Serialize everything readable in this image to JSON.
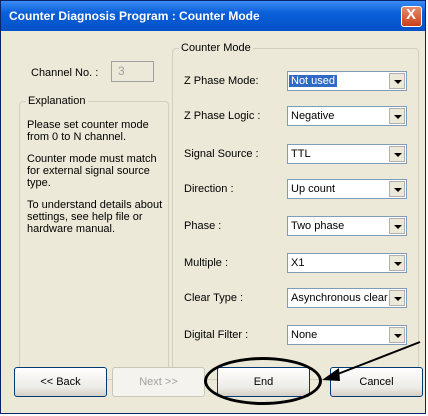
{
  "window": {
    "title": "Counter Diagnosis Program : Counter Mode",
    "close_label": "X"
  },
  "channel": {
    "label": "Channel No. :",
    "value": "3"
  },
  "explanation": {
    "title": "Explanation",
    "paragraphs": [
      "Please set counter mode from 0 to N channel.",
      "Counter mode must match for external signal source type.",
      "To understand details about settings, see help file or hardware manual."
    ]
  },
  "counter_mode": {
    "title": "Counter Mode",
    "fields": [
      {
        "label": "Z Phase Mode:",
        "value": "Not used"
      },
      {
        "label": "Z Phase Logic :",
        "value": "Negative"
      },
      {
        "label": "Signal Source :",
        "value": "TTL"
      },
      {
        "label": "Direction :",
        "value": "Up count"
      },
      {
        "label": "Phase :",
        "value": "Two phase"
      },
      {
        "label": "Multiple :",
        "value": "X1"
      },
      {
        "label": "Clear Type :",
        "value": "Asynchronous clear"
      },
      {
        "label": "Digital Filter :",
        "value": "None"
      }
    ]
  },
  "buttons": {
    "back": "<< Back",
    "next": "Next >>",
    "end": "End",
    "cancel": "Cancel"
  }
}
